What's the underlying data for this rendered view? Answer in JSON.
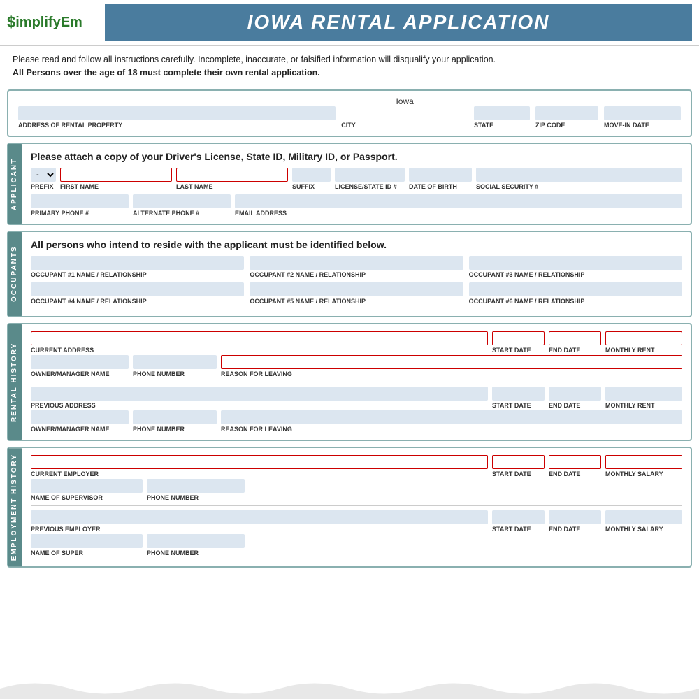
{
  "header": {
    "logo_dollar": "$",
    "logo_name": "implifyEm",
    "title": "IOWA RENTAL APPLICATION"
  },
  "intro": {
    "line1": "Please read and follow all instructions carefully. Incomplete, inaccurate, or falsified information will disqualify your application.",
    "line2": "All Persons over the age of 18 must complete their own rental application."
  },
  "property": {
    "city_value": "Iowa",
    "address_label": "ADDRESS OF RENTAL PROPERTY",
    "city_label": "CITY",
    "state_label": "STATE",
    "zip_label": "ZIP CODE",
    "movein_label": "MOVE-IN DATE"
  },
  "applicant": {
    "tab_label": "APPLICANT",
    "instruction": "Please attach a copy of your Driver's License, State ID, Military ID, or Passport.",
    "prefix_label": "PREFIX",
    "firstname_label": "FIRST NAME",
    "lastname_label": "LAST NAME",
    "suffix_label": "SUFFIX",
    "license_label": "LICENSE/STATE ID #",
    "dob_label": "DATE OF BIRTH",
    "ssn_label": "SOCIAL SECURITY #",
    "phone_label": "PRIMARY PHONE #",
    "altphone_label": "ALTERNATE PHONE #",
    "email_label": "EMAIL ADDRESS"
  },
  "occupants": {
    "tab_label": "OCCUPANTS",
    "instruction": "All persons who intend to reside with the applicant must be identified below.",
    "occ1_label": "OCCUPANT #1 NAME / RELATIONSHIP",
    "occ2_label": "OCCUPANT #2 NAME / RELATIONSHIP",
    "occ3_label": "OCCUPANT #3 NAME / RELATIONSHIP",
    "occ4_label": "OCCUPANT #4 NAME / RELATIONSHIP",
    "occ5_label": "OCCUPANT #5 NAME / RELATIONSHIP",
    "occ6_label": "OCCUPANT #6 NAME / RELATIONSHIP"
  },
  "rental_history": {
    "tab_label": "RENTAL HISTORY",
    "current_address_label": "CURRENT ADDRESS",
    "start_date_label": "START DATE",
    "end_date_label": "END DATE",
    "monthly_rent_label": "MONTHLY RENT",
    "owner_label": "OWNER/MANAGER NAME",
    "phone_label": "PHONE NUMBER",
    "reason_label": "REASON FOR LEAVING",
    "previous_address_label": "PREVIOUS ADDRESS",
    "prev_start_label": "START DATE",
    "prev_end_label": "END DATE",
    "prev_rent_label": "MONTHLY RENT",
    "prev_owner_label": "OWNER/MANAGER NAME",
    "prev_phone_label": "PHONE NUMBER",
    "prev_reason_label": "REASON FOR LEAVING"
  },
  "employment_history": {
    "tab_label": "EMPLOYMENT HISTORY",
    "current_employer_label": "CURRENT EMPLOYER",
    "start_date_label": "START DATE",
    "end_date_label": "END DATE",
    "monthly_salary_label": "MONTHLY SALARY",
    "supervisor_label": "NAME OF SUPERVISOR",
    "phone_label": "PHONE NUMBER",
    "prev_employer_label": "PREVIOUS EMPLOYER",
    "prev_start_label": "START DATE",
    "prev_end_label": "END DATE",
    "prev_salary_label": "MONTHLY SALARY",
    "prev_super_label": "NAME OF SUPER",
    "prev_phone_label": "PHONE NUMBER"
  }
}
